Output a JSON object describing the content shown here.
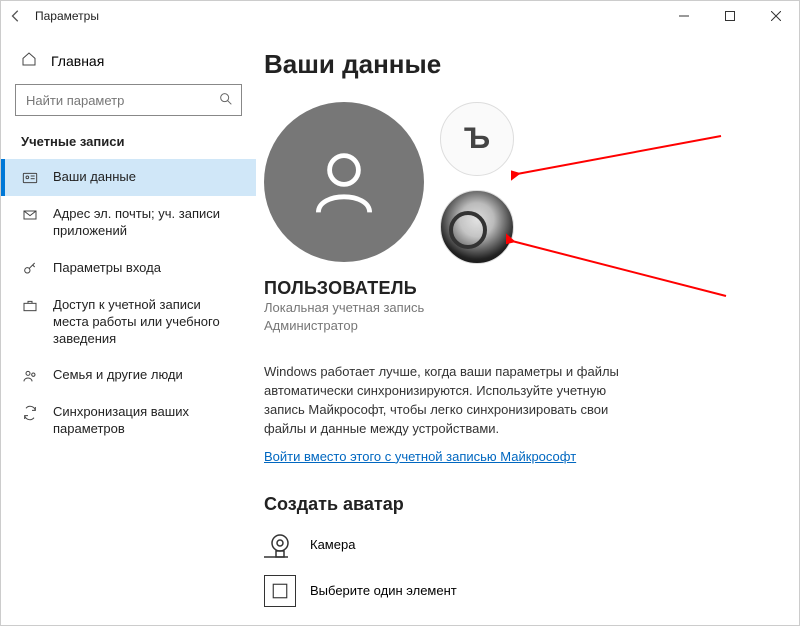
{
  "window": {
    "title": "Параметры"
  },
  "sidebar": {
    "home": "Главная",
    "search_placeholder": "Найти параметр",
    "group": "Учетные записи",
    "items": [
      {
        "label": "Ваши данные"
      },
      {
        "label": "Адрес эл. почты; уч. записи приложений"
      },
      {
        "label": "Параметры входа"
      },
      {
        "label": "Доступ к учетной записи места работы или учебного заведения"
      },
      {
        "label": "Семья и другие люди"
      },
      {
        "label": "Синхронизация ваших параметров"
      }
    ]
  },
  "main": {
    "heading": "Ваши данные",
    "username": "ПОЛЬЗОВАТЕЛЬ",
    "account_type": "Локальная учетная запись",
    "role": "Администратор",
    "info_text": "Windows работает лучше, когда ваши параметры и файлы автоматически синхронизируются. Используйте учетную запись Майкрософт, чтобы легко синхронизировать свои файлы и данные между устройствами.",
    "signin_link": "Войти вместо этого с учетной записью Майкрософт",
    "create_avatar_heading": "Создать аватар",
    "option_camera": "Камера",
    "option_browse": "Выберите один элемент",
    "alt_avatar_glyph": "Ъ"
  },
  "annotations": {
    "arrow1_target": "previous-avatar-1",
    "arrow2_target": "previous-avatar-2"
  }
}
